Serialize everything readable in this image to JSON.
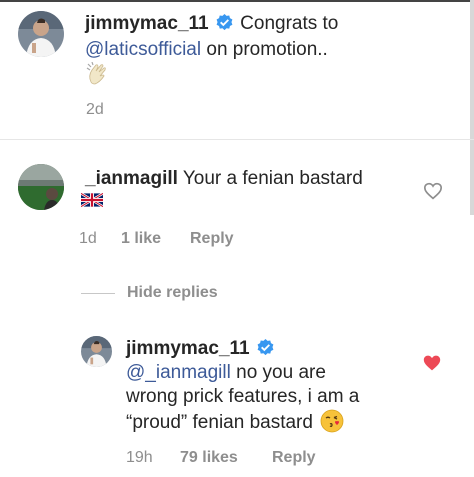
{
  "colors": {
    "link": "#3d5a98",
    "verified": "#3897f0",
    "meta": "#8e8e8e",
    "liked": "#ed4956"
  },
  "post": {
    "username": "jimmymac_11",
    "verified_icon": "verified-badge-icon",
    "text_1": "Congrats to",
    "mention": "@laticsofficial",
    "text_2": "on promotion..",
    "emoji": "clapping-hands-icon",
    "time": "2d"
  },
  "comment": {
    "username": "_ianmagill",
    "text": "Your a fenian bastard",
    "flag": "union-jack-flag-icon",
    "time": "1d",
    "likes": "1 like",
    "reply": "Reply",
    "hide_replies": "Hide replies",
    "like_icon": "heart-outline-icon"
  },
  "reply": {
    "username": "jimmymac_11",
    "verified_icon": "verified-badge-icon",
    "mention": "@_ianmagill",
    "line1_rest": "no you are",
    "line2": "wrong prick features, i am a",
    "line3": "“proud” fenian bastard",
    "emoji": "face-blowing-kiss-icon",
    "time": "19h",
    "likes": "79 likes",
    "reply": "Reply",
    "like_icon": "heart-filled-icon"
  }
}
